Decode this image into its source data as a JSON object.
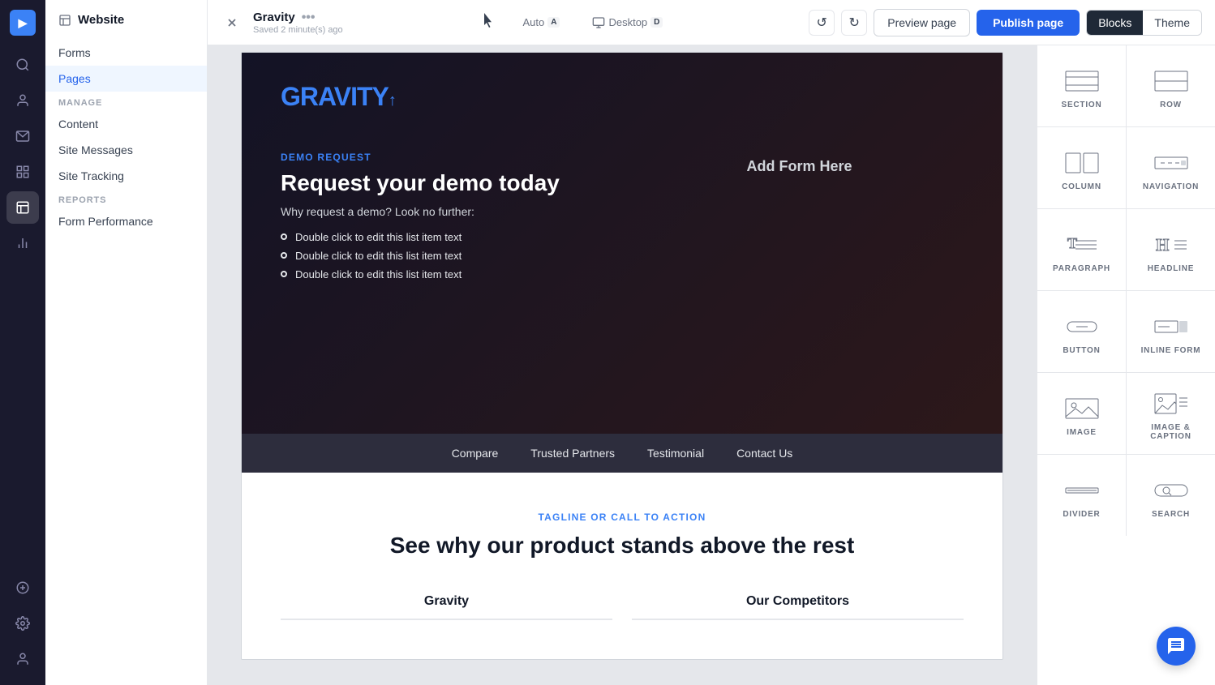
{
  "app": {
    "title": "Website"
  },
  "topbar": {
    "close_label": "✕",
    "page_title": "Gravity",
    "page_dots": "•••",
    "saved_text": "Saved 2 minute(s) ago",
    "auto_label": "Auto",
    "auto_badge": "A",
    "desktop_label": "Desktop",
    "desktop_badge": "D",
    "undo_label": "↺",
    "redo_label": "↻",
    "preview_label": "Preview page",
    "publish_label": "Publish page",
    "blocks_label": "Blocks",
    "theme_label": "Theme"
  },
  "sidebar": {
    "header_label": "Website",
    "items": [
      {
        "id": "forms",
        "label": "Forms"
      },
      {
        "id": "pages",
        "label": "Pages",
        "active": true
      }
    ],
    "manage_label": "MANAGE",
    "manage_items": [
      {
        "id": "content",
        "label": "Content"
      },
      {
        "id": "site-messages",
        "label": "Site Messages"
      },
      {
        "id": "site-tracking",
        "label": "Site Tracking"
      }
    ],
    "reports_label": "REPORTS",
    "reports_items": [
      {
        "id": "form-performance",
        "label": "Form Performance"
      }
    ]
  },
  "hero": {
    "logo": "GRAVITY",
    "logo_cursor": "↑",
    "tag": "DEMO REQUEST",
    "title": "Request your demo today",
    "subtitle": "Why request a demo? Look no further:",
    "list_items": [
      "Double click to edit this list item text",
      "Double click to edit this list item text",
      "Double click to edit this list item text"
    ],
    "form_placeholder": "Add Form Here"
  },
  "navbar": {
    "links": [
      "Compare",
      "Trusted Partners",
      "Testimonial",
      "Contact Us"
    ]
  },
  "content_section": {
    "tag": "TAGLINE OR CALL TO ACTION",
    "title": "See why our product stands above the rest",
    "col1_header": "Gravity",
    "col2_header": "Our Competitors"
  },
  "blocks_panel": {
    "items": [
      {
        "id": "section",
        "label": "SECTION"
      },
      {
        "id": "row",
        "label": "ROW"
      },
      {
        "id": "column",
        "label": "COLUMN"
      },
      {
        "id": "navigation",
        "label": "NAVIGATION"
      },
      {
        "id": "paragraph",
        "label": "PARAGRAPH"
      },
      {
        "id": "headline",
        "label": "HEADLINE"
      },
      {
        "id": "button",
        "label": "BUTTON"
      },
      {
        "id": "inline-form",
        "label": "INLINE FORM"
      },
      {
        "id": "image",
        "label": "IMAGE"
      },
      {
        "id": "image-caption",
        "label": "IMAGE & CAPTION"
      },
      {
        "id": "divider",
        "label": "DIVIDER"
      },
      {
        "id": "search",
        "label": "SEARCH"
      }
    ]
  },
  "icons": {
    "search": "🔍",
    "users": "👤",
    "mail": "✉",
    "grid": "⊞",
    "chart": "📊",
    "plus": "＋",
    "gear": "⚙",
    "person": "👤"
  }
}
